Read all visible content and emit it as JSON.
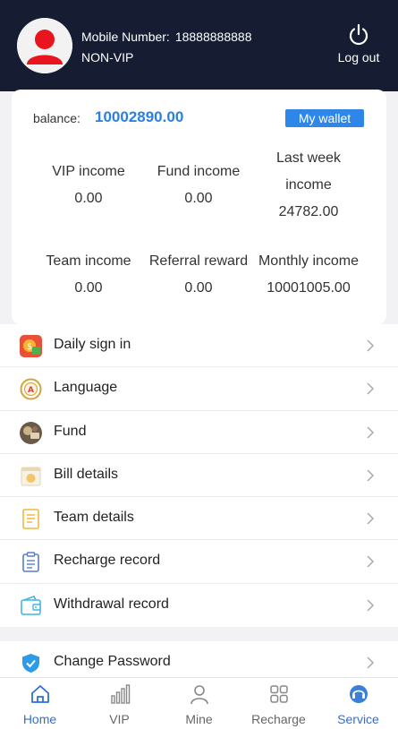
{
  "header": {
    "mobile_label": "Mobile Number:",
    "mobile_number": "18888888888",
    "vip_status": "NON-VIP",
    "logout_label": "Log out"
  },
  "card": {
    "balance_label": "balance:",
    "balance_value": "10002890.00",
    "wallet_button": "My wallet",
    "stats": [
      {
        "label": "VIP income",
        "value": "0.00"
      },
      {
        "label": "Fund income",
        "value": "0.00"
      },
      {
        "label_line1": "Last week",
        "label_line2": "income",
        "value": "24782.00"
      },
      {
        "label": "Team income",
        "value": "0.00"
      },
      {
        "label": "Referral reward",
        "value": "0.00"
      },
      {
        "label": "Monthly income",
        "value": "10001005.00"
      }
    ]
  },
  "menu": {
    "items": [
      {
        "label": "Daily sign in",
        "icon": "daily-sign-in-icon"
      },
      {
        "label": "Language",
        "icon": "language-icon"
      },
      {
        "label": "Fund",
        "icon": "fund-icon"
      },
      {
        "label": "Bill details",
        "icon": "bill-icon"
      },
      {
        "label": "Team details",
        "icon": "team-details-icon"
      },
      {
        "label": "Recharge record",
        "icon": "clipboard-icon"
      },
      {
        "label": "Withdrawal record",
        "icon": "wallet-icon"
      }
    ],
    "items2": [
      {
        "label": "Change Password",
        "icon": "shield-icon"
      }
    ]
  },
  "nav": {
    "items": [
      {
        "label": "Home",
        "icon": "home-icon",
        "active": true
      },
      {
        "label": "VIP",
        "icon": "bar-chart-icon"
      },
      {
        "label": "Mine",
        "icon": "person-icon"
      },
      {
        "label": "Recharge",
        "icon": "grid-icon"
      },
      {
        "label": "Service",
        "icon": "headset-icon"
      }
    ]
  },
  "colors": {
    "header_bg": "#161d33",
    "accent": "#2e86e8",
    "balance": "#2a7fe0",
    "nav_active": "#2f6fd6"
  }
}
